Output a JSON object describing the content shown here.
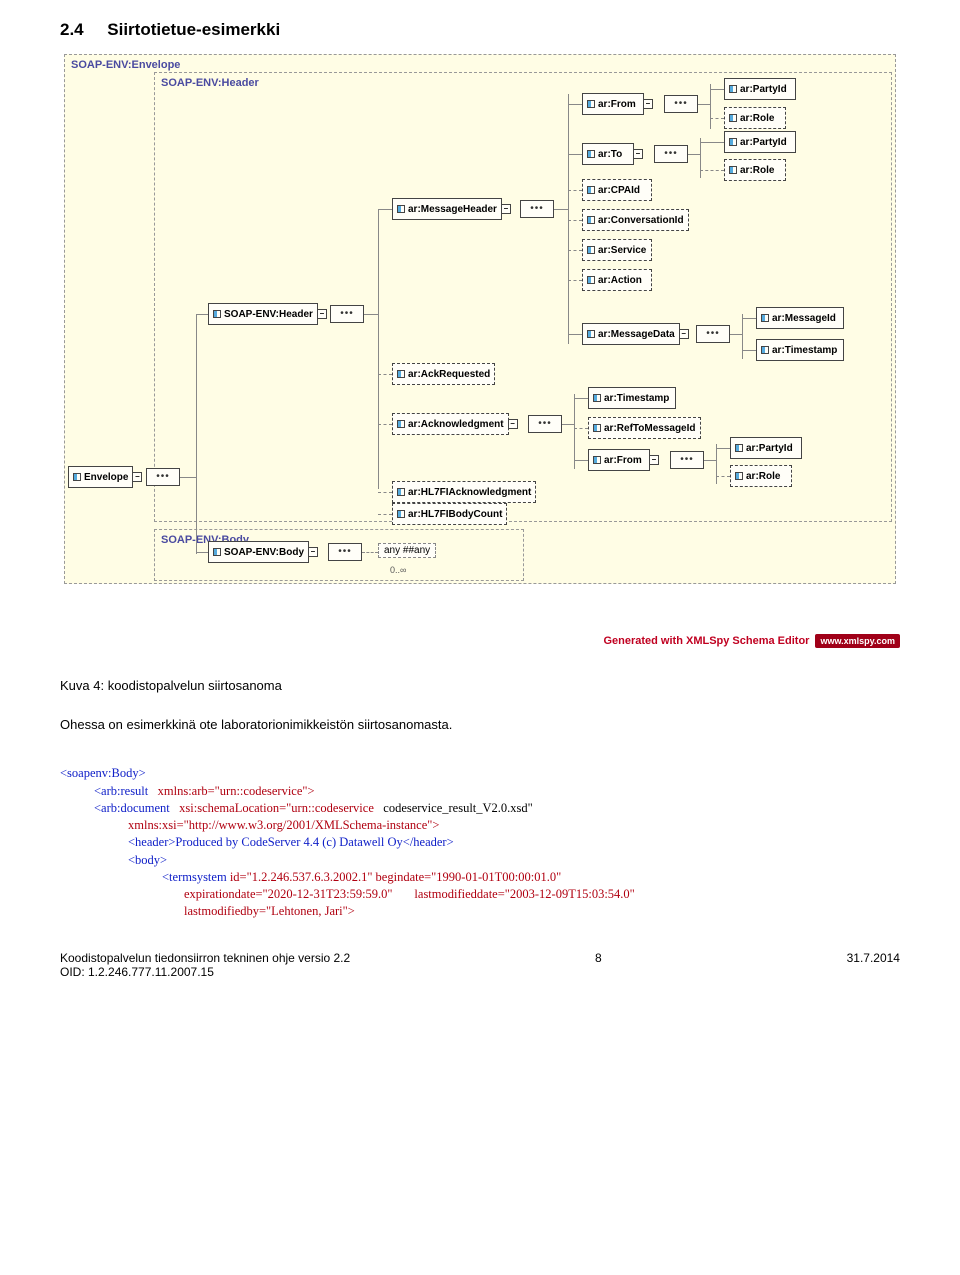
{
  "section": {
    "number": "2.4",
    "title": "Siirtotietue-esimerkki"
  },
  "diagram": {
    "outer_label": "SOAP-ENV:Envelope",
    "header_label": "SOAP-ENV:Header",
    "body_label": "SOAP-ENV:Body",
    "root_node": "Envelope",
    "header_branch_node": "SOAP-ENV:Header",
    "body_branch_node": "SOAP-ENV:Body",
    "msg_header_node": "ar:MessageHeader",
    "ack_req_node": "ar:AckRequested",
    "acknowledgment_node": "ar:Acknowledgment",
    "hl7fi_ack_node": "ar:HL7FIAcknowledgment",
    "hl7fi_bodycount_node": "ar:HL7FIBodyCount",
    "from_node": "ar:From",
    "to_node": "ar:To",
    "cpaid_node": "ar:CPAId",
    "conversation_node": "ar:ConversationId",
    "service_node": "ar:Service",
    "action_node": "ar:Action",
    "message_data_node": "ar:MessageData",
    "partyid_node": "ar:PartyId",
    "role_node": "ar:Role",
    "messageid_node": "ar:MessageId",
    "timestamp_node": "ar:Timestamp",
    "ref_to_msgid_node": "ar:RefToMessageId",
    "any_label": "any ##any",
    "cardinality": "0..∞"
  },
  "generated": {
    "text": "Generated with XMLSpy Schema Editor",
    "badge": "www.xmlspy.com"
  },
  "caption": "Kuva 4:  koodistopalvelun siirtosanoma",
  "intro": "Ohessa on esimerkkinä ote laboratorionimikkeistön siirtosanomasta.",
  "code": {
    "l1": "<soapenv:Body>",
    "l2a": "<arb:result",
    "l2b": "xmlns:arb=\"urn::codeservice\">",
    "l3a": "<arb:document",
    "l3b": "xsi:schemaLocation=\"urn::codeservice",
    "l3c": "codeservice_result_V2.0.xsd\"",
    "l4": "xmlns:xsi=\"http://www.w3.org/2001/XMLSchema-instance\">",
    "l5": "<header>Produced by CodeServer 4.4 (c) Datawell Oy</header>",
    "l6": "<body>",
    "l7a": "<termsystem",
    "l7b": "id=\"1.2.246.537.6.3.2002.1\"",
    "l7c": "begindate=\"1990-01-01T00:00:01.0\"",
    "l8a": "expirationdate=\"2020-12-31T23:59:59.0\"",
    "l8b": "lastmodifieddate=\"2003-12-09T15:03:54.0\"",
    "l9": "lastmodifiedby=\"Lehtonen, Jari\">"
  },
  "footer": {
    "left_line1": "Koodistopalvelun tiedonsiirron tekninen ohje versio 2.2",
    "left_line2": "OID: 1.2.246.777.11.2007.15",
    "center": "8",
    "right": "31.7.2014"
  }
}
